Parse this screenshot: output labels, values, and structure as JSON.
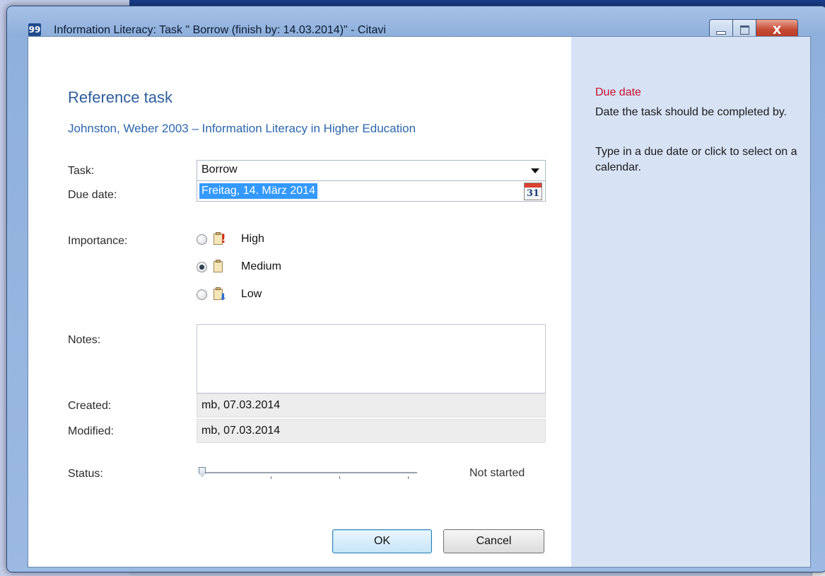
{
  "window": {
    "title": "Information Literacy: Task \" Borrow (finish by: 14.03.2014)\" - Citavi",
    "app_icon_glyph": "99",
    "close_glyph": "X"
  },
  "form": {
    "heading": "Reference task",
    "reference_link": "Johnston, Weber 2003 – Information Literacy in Higher Education",
    "task_label": "Task:",
    "task_value": "Borrow",
    "due_date_label": "Due date:",
    "due_date_value": "Freitag, 14. März 2014",
    "calendar_day": "31",
    "importance_label": "Importance:",
    "importance_options": [
      {
        "label": "High",
        "selected": false,
        "icon": "high-priority-icon"
      },
      {
        "label": "Medium",
        "selected": true,
        "icon": "medium-priority-icon"
      },
      {
        "label": "Low",
        "selected": false,
        "icon": "low-priority-icon"
      }
    ],
    "notes_label": "Notes:",
    "notes_value": "",
    "created_label": "Created:",
    "created_value": "mb, 07.03.2014",
    "modified_label": "Modified:",
    "modified_value": "mb, 07.03.2014",
    "status_label": "Status:",
    "status_value": "Not started",
    "status_level": 0,
    "ok_label": "OK",
    "cancel_label": "Cancel"
  },
  "help": {
    "title": "Due date",
    "paragraph1": "Date the task should be completed by.",
    "paragraph2": "Type in a due date or click to select on a calendar."
  },
  "colors": {
    "help_title": "#c8102e",
    "heading": "#2f5d9c",
    "help_pane_bg": "#d7e3f5",
    "selection": "#3399ff"
  }
}
